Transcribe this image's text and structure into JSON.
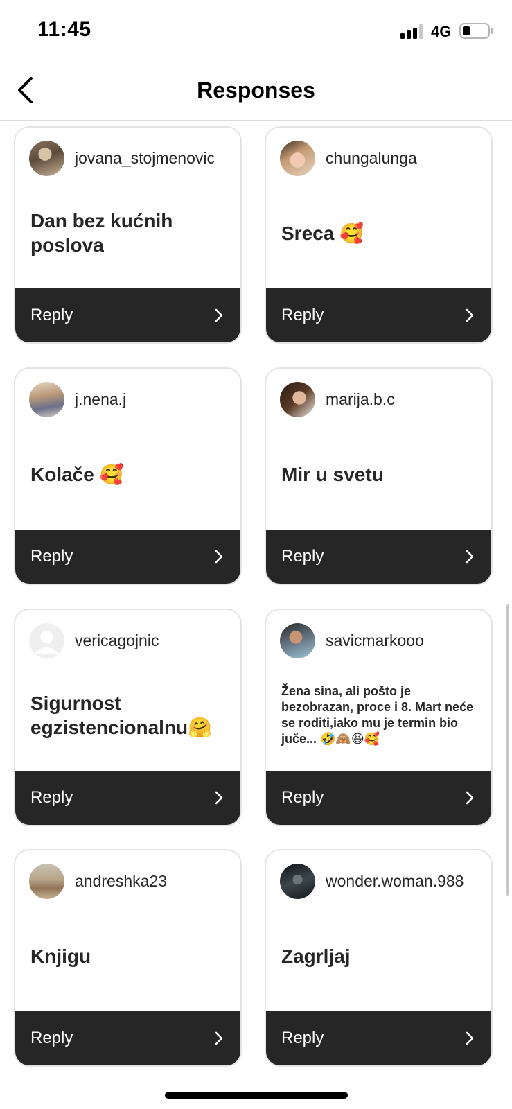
{
  "status": {
    "time": "11:45",
    "network": "4G"
  },
  "nav": {
    "title": "Responses"
  },
  "cards": [
    {
      "username": "jovana_stojmenovic",
      "text": "Dan bez kućnih poslova",
      "reply": "Reply"
    },
    {
      "username": "chungalunga",
      "text": "Sreca 🥰",
      "reply": "Reply"
    },
    {
      "username": "j.nena.j",
      "text": "Kolače 🥰",
      "reply": "Reply"
    },
    {
      "username": "marija.b.c",
      "text": "Mir u svetu",
      "reply": "Reply"
    },
    {
      "username": "vericagojnic",
      "text": "Sigurnost egzistencionalnu🤗",
      "reply": "Reply"
    },
    {
      "username": "savicmarkooo",
      "text": "Žena sina, ali pošto je bezobrazan, proce i 8. Mart neće se roditi,iako mu je termin bio juče... 🤣🙈😆🥰",
      "reply": "Reply"
    },
    {
      "username": "andreshka23",
      "text": "Knjigu",
      "reply": "Reply"
    },
    {
      "username": "wonder.woman.988",
      "text": "Zagrljaj",
      "reply": "Reply"
    }
  ],
  "icons": {
    "back": "chevron-left-icon",
    "reply_arrow": "chevron-right-icon",
    "signal": "cellular-signal-icon",
    "battery": "battery-icon",
    "default_avatar": "default-avatar-icon"
  }
}
